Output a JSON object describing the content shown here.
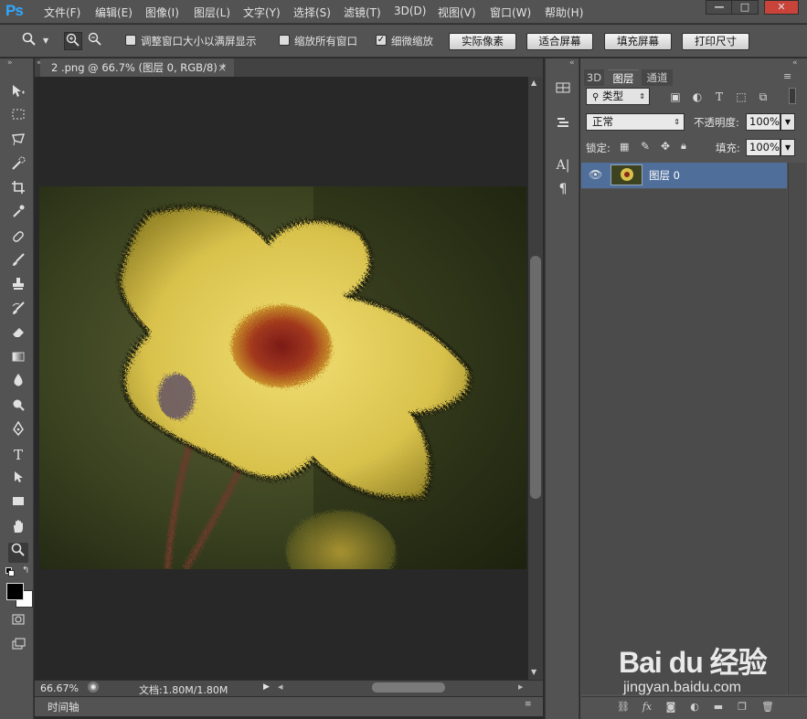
{
  "app": {
    "logo": "Ps"
  },
  "menu": [
    "文件(F)",
    "编辑(E)",
    "图像(I)",
    "图层(L)",
    "文字(Y)",
    "选择(S)",
    "滤镜(T)",
    "3D(D)",
    "视图(V)",
    "窗口(W)",
    "帮助(H)"
  ],
  "window_controls": {
    "minimize": "—",
    "maximize": "□",
    "close": "✕"
  },
  "options": {
    "resize_windows_label": "调整窗口大小以满屏显示",
    "resize_windows_checked": false,
    "zoom_all_label": "缩放所有窗口",
    "zoom_all_checked": false,
    "scrubby_zoom_label": "细微缩放",
    "scrubby_zoom_checked": true,
    "actual_pixels": "实际像素",
    "fit_screen": "适合屏幕",
    "fill_screen": "填充屏幕",
    "print_size": "打印尺寸"
  },
  "document": {
    "tab_title": "2 .png @ 66.7% (图层 0, RGB/8) *",
    "close_glyph": "×",
    "zoom": "66.67%",
    "doc_size": "文档:1.80M/1.80M",
    "timeline_label": "时间轴"
  },
  "layers_panel": {
    "tabs": [
      "3D",
      "图层",
      "通道"
    ],
    "active_tab": "图层",
    "filter_kind": "类型",
    "blend_mode": "正常",
    "opacity_label": "不透明度:",
    "opacity_value": "100%",
    "lock_label": "锁定:",
    "fill_label": "填充:",
    "fill_value": "100%",
    "layers": [
      {
        "name": "图层 0",
        "visible": true
      }
    ]
  },
  "watermark": {
    "main": "Bai du 经验",
    "sub": "jingyan.baidu.com"
  },
  "colors": {
    "ui_bg": "#535353",
    "canvas_bg": "#282828",
    "selected_layer": "#4f6e9a",
    "ps_blue": "#31a8ff"
  }
}
